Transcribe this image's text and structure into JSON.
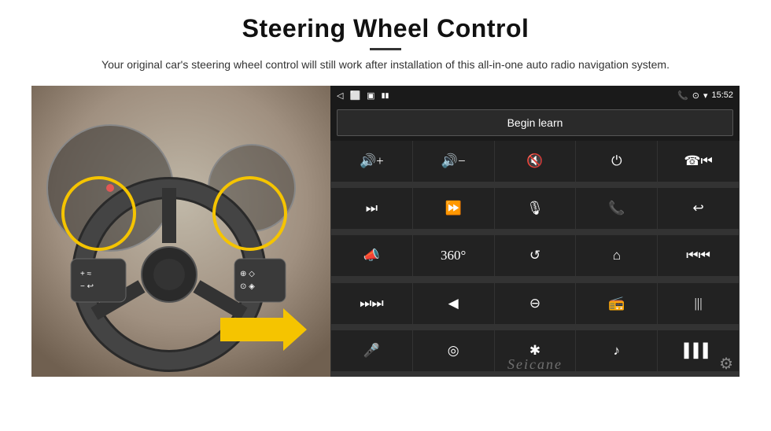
{
  "page": {
    "title": "Steering Wheel Control",
    "subtitle": "Your original car's steering wheel control will still work after installation of this all-in-one auto radio navigation system.",
    "divider": true
  },
  "status_bar": {
    "time": "15:52",
    "icons": [
      "phone",
      "location",
      "wifi",
      "battery"
    ]
  },
  "begin_learn_btn": "Begin learn",
  "controls": [
    {
      "icon": "🔊+",
      "label": "vol-up"
    },
    {
      "icon": "🔊−",
      "label": "vol-down"
    },
    {
      "icon": "🔇",
      "label": "mute"
    },
    {
      "icon": "⏻",
      "label": "power"
    },
    {
      "icon": "📞⏮",
      "label": "phone-prev"
    },
    {
      "icon": "⏭",
      "label": "next"
    },
    {
      "icon": "⏩⏮",
      "label": "fast-next"
    },
    {
      "icon": "🎙",
      "label": "mic"
    },
    {
      "icon": "📞",
      "label": "call"
    },
    {
      "icon": "↩",
      "label": "hang-up"
    },
    {
      "icon": "🔔",
      "label": "horn"
    },
    {
      "icon": "360°",
      "label": "camera-360"
    },
    {
      "icon": "↩",
      "label": "return"
    },
    {
      "icon": "🏠",
      "label": "home"
    },
    {
      "icon": "⏮⏮",
      "label": "prev-track"
    },
    {
      "icon": "⏭⏭",
      "label": "fast-forward"
    },
    {
      "icon": "◀",
      "label": "navigation"
    },
    {
      "icon": "⊖",
      "label": "eject"
    },
    {
      "icon": "📻",
      "label": "radio"
    },
    {
      "icon": "|||",
      "label": "equalizer"
    },
    {
      "icon": "🎤",
      "label": "voice"
    },
    {
      "icon": "⏺",
      "label": "record"
    },
    {
      "icon": "✱",
      "label": "bluetooth"
    },
    {
      "icon": "🎵",
      "label": "music"
    },
    {
      "icon": "📶",
      "label": "signal"
    }
  ],
  "watermark": "Seicane",
  "gear_label": "⚙"
}
